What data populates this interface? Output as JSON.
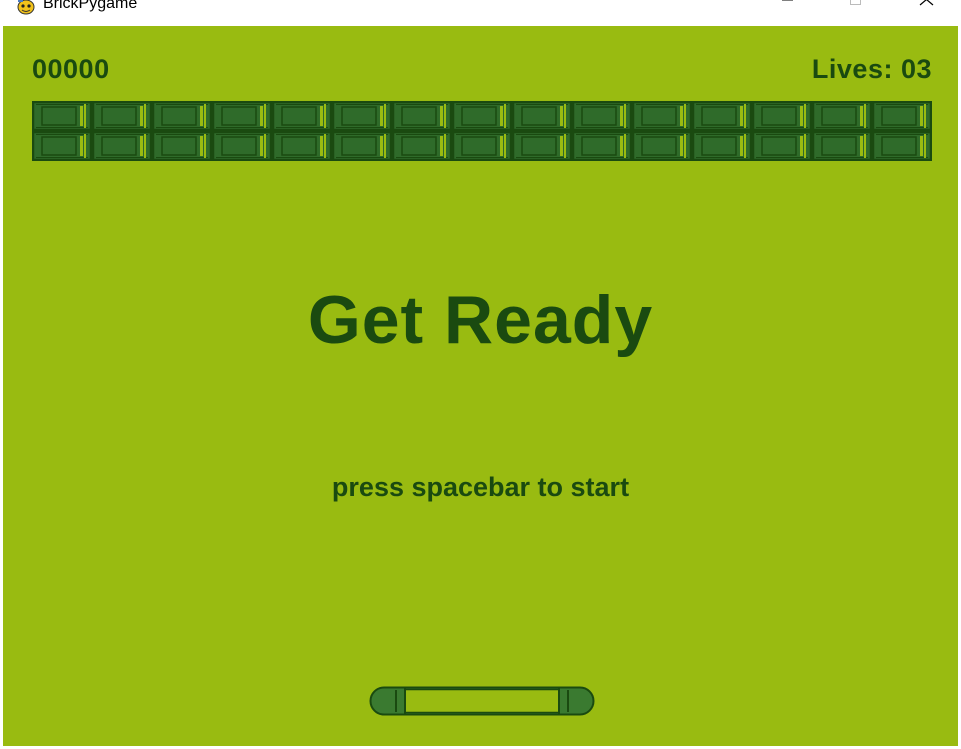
{
  "window": {
    "title": "BrickPygame"
  },
  "hud": {
    "score": "00000",
    "lives": "Lives: 03"
  },
  "messages": {
    "headline": "Get Ready",
    "prompt": "press spacebar to start"
  },
  "bricks": {
    "rows": 2,
    "columns": 15
  },
  "colors": {
    "background": "#99bb11",
    "text": "#1a4a10",
    "brick_fill": "#2f6b2a",
    "brick_dark": "#1a4a10",
    "brick_light": "#99bb11"
  },
  "icons": {
    "app": "pygame-snake-icon",
    "minimize": "minimize-icon",
    "maximize": "maximize-icon",
    "close": "close-icon"
  }
}
